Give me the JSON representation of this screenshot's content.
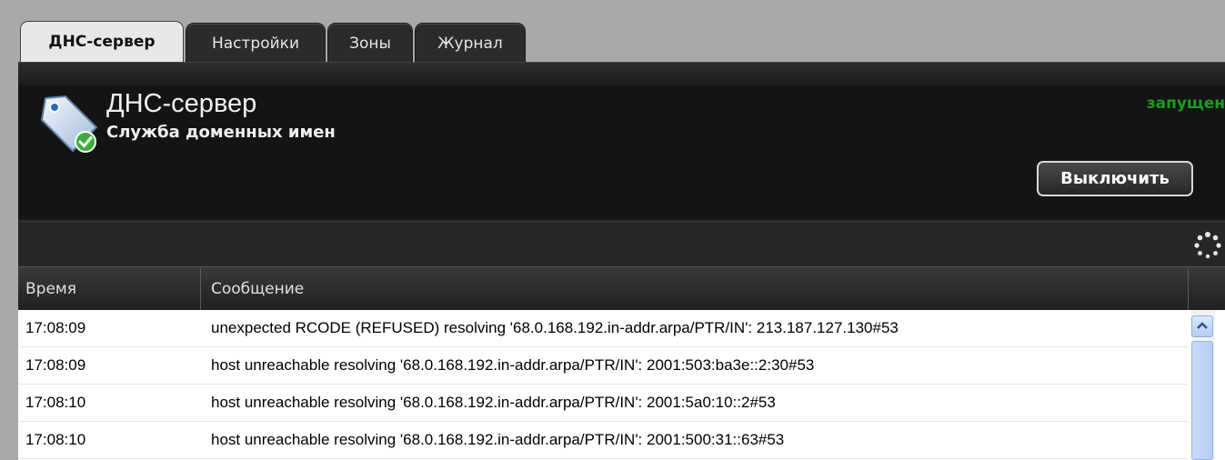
{
  "tabs": [
    {
      "label": "ДНС-сервер",
      "active": true
    },
    {
      "label": "Настройки",
      "active": false
    },
    {
      "label": "Зоны",
      "active": false
    },
    {
      "label": "Журнал",
      "active": false
    }
  ],
  "service": {
    "icon": "dns-tag-check-icon",
    "title": "ДНС-сервер",
    "subtitle": "Служба доменных имен",
    "status": "запущен",
    "status_color": "#1e9b1e",
    "toggle_label": "Выключить"
  },
  "toolbar": {
    "refresh_icon": "loading-spinner-icon"
  },
  "log": {
    "columns": [
      "Время",
      "Сообщение"
    ],
    "rows": [
      {
        "time": "17:08:09",
        "message": "unexpected RCODE (REFUSED) resolving '68.0.168.192.in-addr.arpa/PTR/IN': 213.187.127.130#53"
      },
      {
        "time": "17:08:09",
        "message": "host unreachable resolving '68.0.168.192.in-addr.arpa/PTR/IN': 2001:503:ba3e::2:30#53"
      },
      {
        "time": "17:08:10",
        "message": "host unreachable resolving '68.0.168.192.in-addr.arpa/PTR/IN': 2001:5a0:10::2#53"
      },
      {
        "time": "17:08:10",
        "message": "host unreachable resolving '68.0.168.192.in-addr.arpa/PTR/IN': 2001:500:31::63#53"
      }
    ]
  }
}
